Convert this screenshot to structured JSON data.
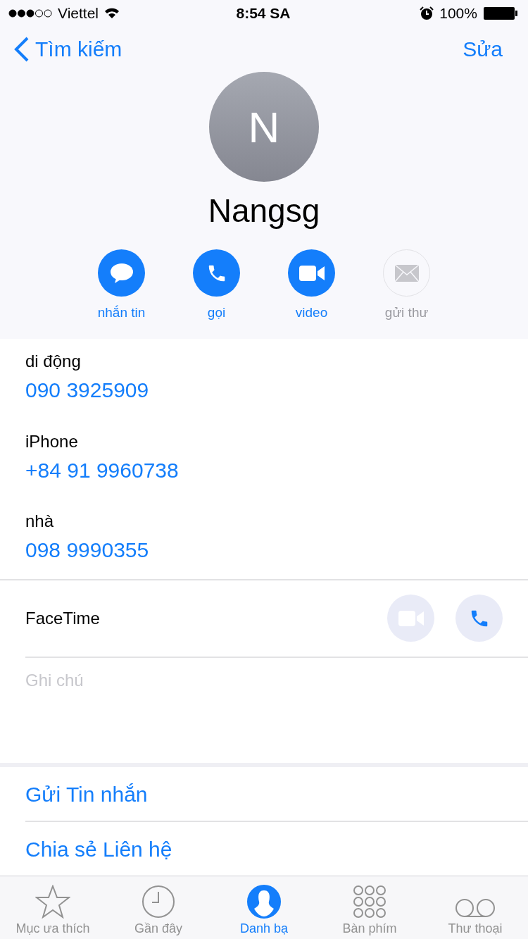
{
  "status_bar": {
    "carrier": "Viettel",
    "time": "8:54 SA",
    "battery": "100%"
  },
  "nav": {
    "back": "Tìm kiếm",
    "edit": "Sửa"
  },
  "contact": {
    "initial": "N",
    "name": "Nangsg"
  },
  "actions": [
    {
      "kind": "message",
      "label": "nhắn tin",
      "disabled": false
    },
    {
      "kind": "call",
      "label": "gọi",
      "disabled": false
    },
    {
      "kind": "video",
      "label": "video",
      "disabled": false
    },
    {
      "kind": "mail",
      "label": "gửi thư",
      "disabled": true
    }
  ],
  "phones": [
    {
      "label": "di động",
      "number": "090 3925909"
    },
    {
      "label": "iPhone",
      "number": "+84 91 9960738"
    },
    {
      "label": "nhà",
      "number": "098 9990355"
    }
  ],
  "facetime": {
    "label": "FaceTime"
  },
  "notes": {
    "placeholder": "Ghi chú"
  },
  "links": [
    "Gửi Tin nhắn",
    "Chia sẻ Liên hệ"
  ],
  "tabs": [
    {
      "kind": "favorites",
      "label": "Mục ưa thích",
      "selected": false
    },
    {
      "kind": "recents",
      "label": "Gần đây",
      "selected": false
    },
    {
      "kind": "contacts",
      "label": "Danh bạ",
      "selected": true
    },
    {
      "kind": "keypad",
      "label": "Bàn phím",
      "selected": false
    },
    {
      "kind": "voicemail",
      "label": "Thư thoại",
      "selected": false
    }
  ]
}
